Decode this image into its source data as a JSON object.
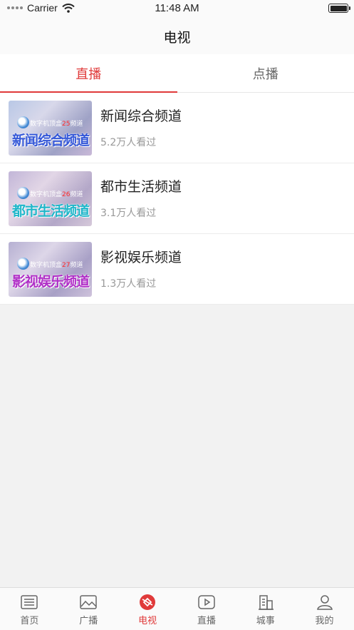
{
  "status_bar": {
    "carrier": "Carrier",
    "time": "11:48 AM"
  },
  "nav": {
    "title": "电视"
  },
  "tabs": [
    {
      "label": "直播",
      "active": true
    },
    {
      "label": "点播",
      "active": false
    }
  ],
  "channels": [
    {
      "name": "新闻综合频道",
      "views": "5.2万人看过",
      "thumb_tag_prefix": "数字机顶盒",
      "thumb_tag_number": "25",
      "thumb_tag_suffix": "频道",
      "thumb_title": "新闻综合频道"
    },
    {
      "name": "都市生活频道",
      "views": "3.1万人看过",
      "thumb_tag_prefix": "数字机顶盒",
      "thumb_tag_number": "26",
      "thumb_tag_suffix": "频道",
      "thumb_title": "都市生活频道"
    },
    {
      "name": "影视娱乐频道",
      "views": "1.3万人看过",
      "thumb_tag_prefix": "数字机顶盒",
      "thumb_tag_number": "27",
      "thumb_tag_suffix": "频道",
      "thumb_title": "影视娱乐频道"
    }
  ],
  "tabbar": [
    {
      "label": "首页",
      "icon": "news-icon",
      "active": false
    },
    {
      "label": "广播",
      "icon": "image-icon",
      "active": false
    },
    {
      "label": "电视",
      "icon": "tv-icon",
      "active": true
    },
    {
      "label": "直播",
      "icon": "play-icon",
      "active": false
    },
    {
      "label": "城事",
      "icon": "building-icon",
      "active": false
    },
    {
      "label": "我的",
      "icon": "profile-icon",
      "active": false
    }
  ],
  "colors": {
    "accent": "#e03a3a",
    "background": "#f2f2f2"
  }
}
